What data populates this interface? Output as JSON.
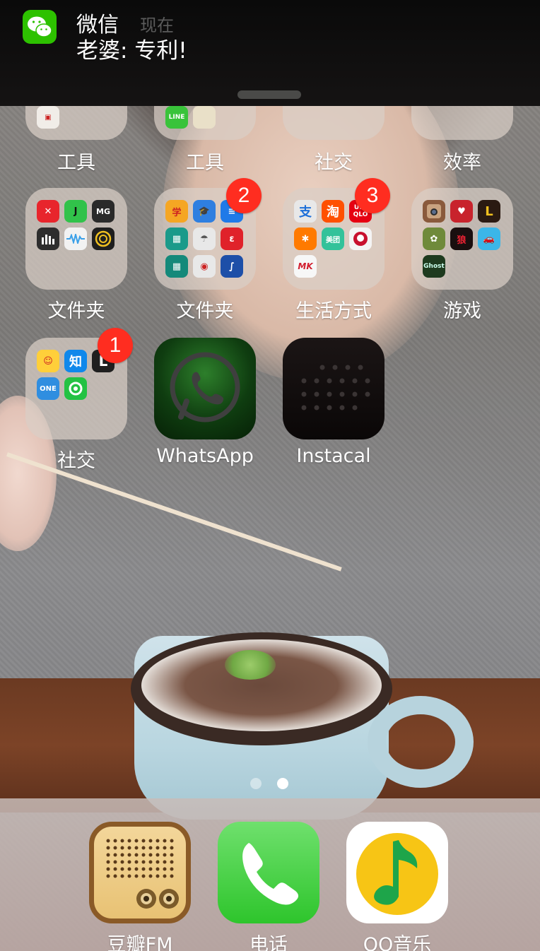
{
  "notification": {
    "app_name": "微信",
    "time": "现在",
    "message": "老婆: 专利!",
    "icon": "wechat-icon",
    "accent_color": "#2dc100"
  },
  "cropped_row": {
    "labels": [
      "工具",
      "工具",
      "社交",
      "效率"
    ]
  },
  "rows": {
    "row1": [
      {
        "label": "文件夹",
        "type": "folder",
        "badge": "",
        "mini_icons": [
          {
            "icon": "red-app-icon",
            "text": "",
            "color": "#e8252c"
          },
          {
            "icon": "j-app-icon",
            "text": "J",
            "color": "#31c24a"
          },
          {
            "icon": "mg-app-icon",
            "text": "MG",
            "color": "#2a2a2a"
          },
          {
            "icon": "bars-app-icon",
            "text": "",
            "color": "#2d2d2d"
          },
          {
            "icon": "wave-app-icon",
            "text": "",
            "color": "#f2f2f2"
          },
          {
            "icon": "ring-app-icon",
            "text": "",
            "color": "#1f1f1f"
          }
        ]
      },
      {
        "label": "文件夹",
        "type": "folder",
        "badge": "2",
        "mini_icons": [
          {
            "icon": "ticket-app-icon",
            "text": "",
            "color": "#f5a623"
          },
          {
            "icon": "graduation-app-icon",
            "text": "",
            "color": "#2f7fe0"
          },
          {
            "icon": "blue-app-icon",
            "text": "",
            "color": "#1f7ae8"
          },
          {
            "icon": "teal-app-icon",
            "text": "",
            "color": "#1a9a8a"
          },
          {
            "icon": "umbrella-app-icon",
            "text": "",
            "color": "#e8e8e8"
          },
          {
            "icon": "red-e-app-icon",
            "text": "",
            "color": "#e0222a"
          },
          {
            "icon": "teal2-app-icon",
            "text": "",
            "color": "#14897a"
          },
          {
            "icon": "bank-app-icon",
            "text": "",
            "color": "#e8e8e8"
          },
          {
            "icon": "script-app-icon",
            "text": "",
            "color": "#1d4fa8"
          }
        ]
      },
      {
        "label": "生活方式",
        "type": "folder",
        "badge": "3",
        "mini_icons": [
          {
            "icon": "alipay-app-icon",
            "text": "支",
            "color": "#e8e8e8"
          },
          {
            "icon": "taobao-app-icon",
            "text": "淘",
            "color": "#ff5000"
          },
          {
            "icon": "uniqlo-app-icon",
            "text": "UNI QLO",
            "color": "#e60012"
          },
          {
            "icon": "person-app-icon",
            "text": "",
            "color": "#ff7a00"
          },
          {
            "icon": "meituan-app-icon",
            "text": "美团",
            "color": "#33c29a"
          },
          {
            "icon": "kfc-app-icon",
            "text": "",
            "color": "#f4f4f4"
          },
          {
            "icon": "mk-app-icon",
            "text": "MK",
            "color": "#f7f7f7"
          }
        ]
      },
      {
        "label": "游戏",
        "type": "folder",
        "badge": "",
        "mini_icons": [
          {
            "icon": "instagram-app-icon",
            "text": "",
            "color": "#8a5a3c"
          },
          {
            "icon": "heart-game-icon",
            "text": "",
            "color": "#c8232c"
          },
          {
            "icon": "l-game-icon",
            "text": "L",
            "color": "#2a1a12"
          },
          {
            "icon": "plant-game-icon",
            "text": "",
            "color": "#6f8a3a"
          },
          {
            "icon": "wolf-game-icon",
            "text": "",
            "color": "#1a0f0f"
          },
          {
            "icon": "car-game-icon",
            "text": "",
            "color": "#3bb6e8"
          },
          {
            "icon": "ghost-app-icon",
            "text": "Ghost",
            "color": "#1e3a1e"
          }
        ]
      }
    ],
    "row2": [
      {
        "label": "社交",
        "type": "folder",
        "badge": "1",
        "mini_icons": [
          {
            "icon": "emoji-app-icon",
            "text": "",
            "color": "#ffcf3a"
          },
          {
            "icon": "zhihu-app-icon",
            "text": "知",
            "color": "#0f88eb"
          },
          {
            "icon": "l-app-icon",
            "text": "L",
            "color": "#1f1f1f"
          },
          {
            "icon": "one-app-icon",
            "text": "ONE",
            "color": "#2f8ee0"
          },
          {
            "icon": "green-chat-app-icon",
            "text": "",
            "color": "#23c243"
          }
        ]
      },
      {
        "label": "WhatsApp",
        "type": "app",
        "badge": "",
        "icon": "whatsapp-icon"
      },
      {
        "label": "Instacal",
        "type": "app",
        "badge": "",
        "icon": "instacal-icon"
      }
    ]
  },
  "page_dots": {
    "count": 2,
    "active": 2
  },
  "dock": [
    {
      "label": "豆瓣FM",
      "icon": "douban-fm-icon"
    },
    {
      "label": "电话",
      "icon": "phone-icon"
    },
    {
      "label": "QQ音乐",
      "icon": "qq-music-icon"
    }
  ]
}
